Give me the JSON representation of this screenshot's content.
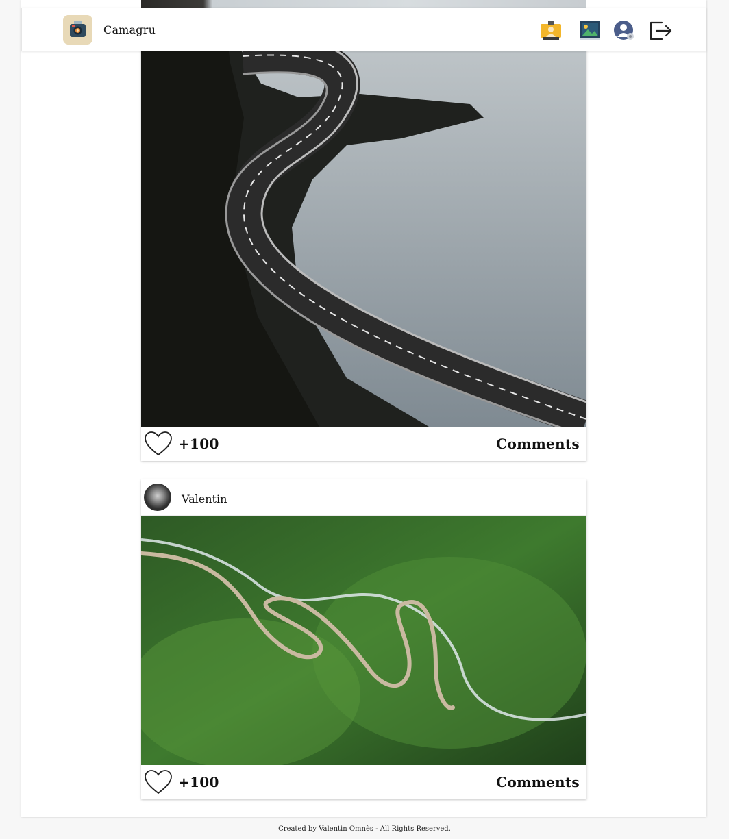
{
  "app": {
    "title": "Camagru"
  },
  "header": {
    "icons": [
      "camera-logo-icon",
      "webcam-icon",
      "gallery-icon",
      "user-settings-icon",
      "logout-icon"
    ]
  },
  "posts": [
    {
      "author": "",
      "likes": "+100",
      "comments_label": "Comments"
    },
    {
      "author": "Valentin",
      "likes": "+100",
      "comments_label": "Comments"
    }
  ],
  "footer": {
    "text": "Created by Valentin Omnès - All Rights Reserved."
  },
  "colors": {
    "accent_logo_bg": "#e8d9b7",
    "page_bg": "#f7f7f7",
    "card_bg": "#ffffff"
  }
}
